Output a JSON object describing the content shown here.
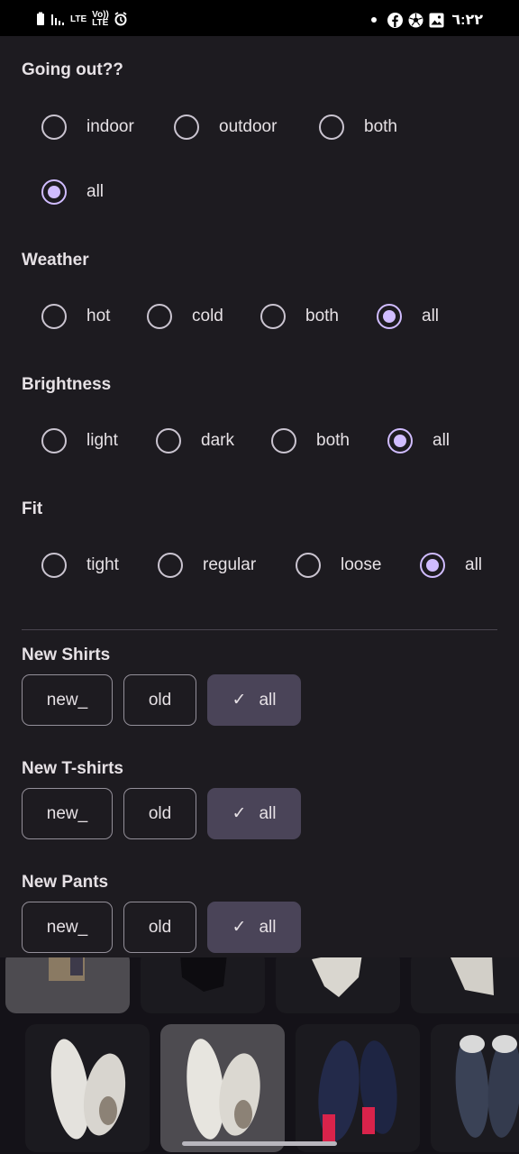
{
  "status_bar": {
    "left_icons": [
      "battery-icon",
      "signal-icon"
    ],
    "lte1": "LTE",
    "volte": "Vo)) LTE",
    "alarm_icon": "alarm-icon",
    "right_icons": [
      "facebook-icon",
      "soccer-ball-icon",
      "gallery-icon"
    ],
    "time": "٦:٢٢"
  },
  "filters": {
    "going_out": {
      "title": "Going out??",
      "options": [
        "indoor",
        "outdoor",
        "both",
        "all"
      ],
      "selected": "all"
    },
    "weather": {
      "title": "Weather",
      "options": [
        "hot",
        "cold",
        "both",
        "all"
      ],
      "selected": "all"
    },
    "brightness": {
      "title": "Brightness",
      "options": [
        "light",
        "dark",
        "both",
        "all"
      ],
      "selected": "all"
    },
    "fit": {
      "title": "Fit",
      "options": [
        "tight",
        "regular",
        "loose",
        "all"
      ],
      "selected": "all"
    }
  },
  "chip_groups": [
    {
      "title": "New Shirts",
      "chips": [
        "new_",
        "old",
        "all"
      ],
      "selected": "all"
    },
    {
      "title": "New T-shirts",
      "chips": [
        "new_",
        "old",
        "all"
      ],
      "selected": "all"
    },
    {
      "title": "New Pants",
      "chips": [
        "new_",
        "old",
        "all"
      ],
      "selected": "all"
    }
  ],
  "check_icon": "check-icon",
  "colors": {
    "accent": "#d0bcff",
    "sheet_bg": "#1d1b20",
    "chip_selected_bg": "#4a4458",
    "text": "#e6e1e5"
  }
}
